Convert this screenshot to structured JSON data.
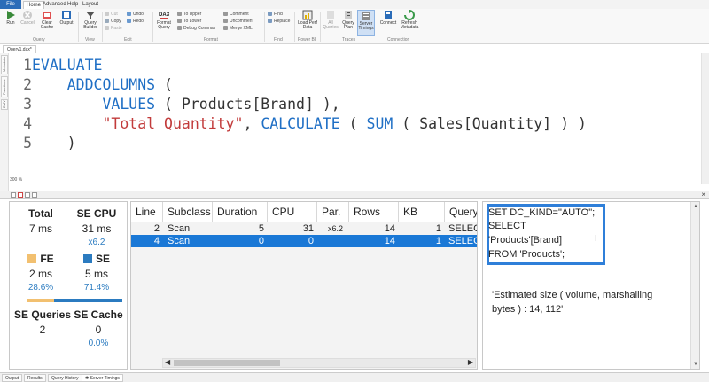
{
  "ribbon_tabs": [
    "File",
    "Home",
    "Advanced",
    "Help",
    "Layout"
  ],
  "ribbon": {
    "run": "Run",
    "cancel": "Cancel",
    "clear_cache": "Clear Cache",
    "output": "Output",
    "query_builder": "Query Builder",
    "cut": "Cut",
    "copy": "Copy",
    "paste": "Paste",
    "undo": "Undo",
    "redo": "Redo",
    "format_query": "Format Query",
    "to_upper": "To Upper",
    "to_lower": "To Lower",
    "debug_commas": "Debug Commas",
    "comment": "Comment",
    "uncomment": "Uncomment",
    "merge_xml": "Merge XML",
    "find": "Find",
    "replace": "Replace",
    "load_perf_data": "Load Perf Data",
    "all_queries": "All Queries",
    "query_plan": "Query Plan",
    "server_timings": "Server Timings",
    "connect": "Connect",
    "refresh_metadata": "Refresh Metadata",
    "groups": {
      "query": "Query",
      "view": "View",
      "edit": "Edit",
      "format": "Format",
      "find": "Find",
      "power_bi": "Power BI",
      "traces": "Traces",
      "connection": "Connection"
    }
  },
  "doc_tab": "Query1.dax*",
  "side_tabs": [
    "Metadata",
    "Functions",
    "DMV"
  ],
  "editor": {
    "zoom": "300 %",
    "lines": [
      {
        "num": "1",
        "indent": "",
        "tokens": [
          {
            "t": "EVALUATE",
            "c": "kw"
          }
        ]
      },
      {
        "num": "2",
        "indent": "    ",
        "tokens": [
          {
            "t": "ADDCOLUMNS",
            "c": "kw"
          },
          {
            "t": " (",
            "c": "pn"
          }
        ]
      },
      {
        "num": "3",
        "indent": "        ",
        "tokens": [
          {
            "t": "VALUES",
            "c": "kw"
          },
          {
            "t": " ( Products[Brand] ),",
            "c": "pn"
          }
        ]
      },
      {
        "num": "4",
        "indent": "        ",
        "tokens": [
          {
            "t": "\"Total Quantity\"",
            "c": "str"
          },
          {
            "t": ", ",
            "c": "pn"
          },
          {
            "t": "CALCULATE",
            "c": "kw"
          },
          {
            "t": " ( ",
            "c": "pn"
          },
          {
            "t": "SUM",
            "c": "kw"
          },
          {
            "t": " ( Sales[Quantity] ) )",
            "c": "pn"
          }
        ]
      },
      {
        "num": "5",
        "indent": "    ",
        "tokens": [
          {
            "t": ")",
            "c": "pn"
          }
        ]
      }
    ]
  },
  "timings": {
    "total_label": "Total",
    "total_value": "7 ms",
    "se_cpu_label": "SE CPU",
    "se_cpu_value": "31 ms",
    "se_cpu_ratio": "x6.2",
    "fe_label": "FE",
    "fe_value": "2 ms",
    "fe_pct": "28.6%",
    "se_label": "SE",
    "se_value": "5 ms",
    "se_pct": "71.4%",
    "fe_fraction": 0.286,
    "se_queries_label": "SE Queries",
    "se_queries_value": "2",
    "se_cache_label": "SE Cache",
    "se_cache_value": "0",
    "se_cache_pct": "0.0%",
    "fe_color": "#f2c070",
    "se_color": "#2b7bc0"
  },
  "grid": {
    "columns": [
      "Line",
      "Subclass",
      "Duration",
      "CPU",
      "Par.",
      "Rows",
      "KB",
      "Query"
    ],
    "rows": [
      {
        "line": "2",
        "subclass": "Scan",
        "duration": "5",
        "cpu": "31",
        "par": "x6.2",
        "rows": "14",
        "kb": "1",
        "query": "SELECT"
      },
      {
        "line": "4",
        "subclass": "Scan",
        "duration": "0",
        "cpu": "0",
        "par": "",
        "rows": "14",
        "kb": "1",
        "query": "SELECT"
      }
    ],
    "selected_row": 1
  },
  "query_text": {
    "lines": [
      "SET DC_KIND=\"AUTO\";",
      "SELECT",
      "'Products'[Brand]",
      "FROM 'Products';"
    ],
    "estimate": [
      "'Estimated size ( volume, marshalling",
      "bytes ) : 14, 112'"
    ]
  },
  "bottom_tabs": [
    "Output",
    "Results",
    "Query History",
    "Server Timings"
  ],
  "accent_color": "#2f7fd9"
}
